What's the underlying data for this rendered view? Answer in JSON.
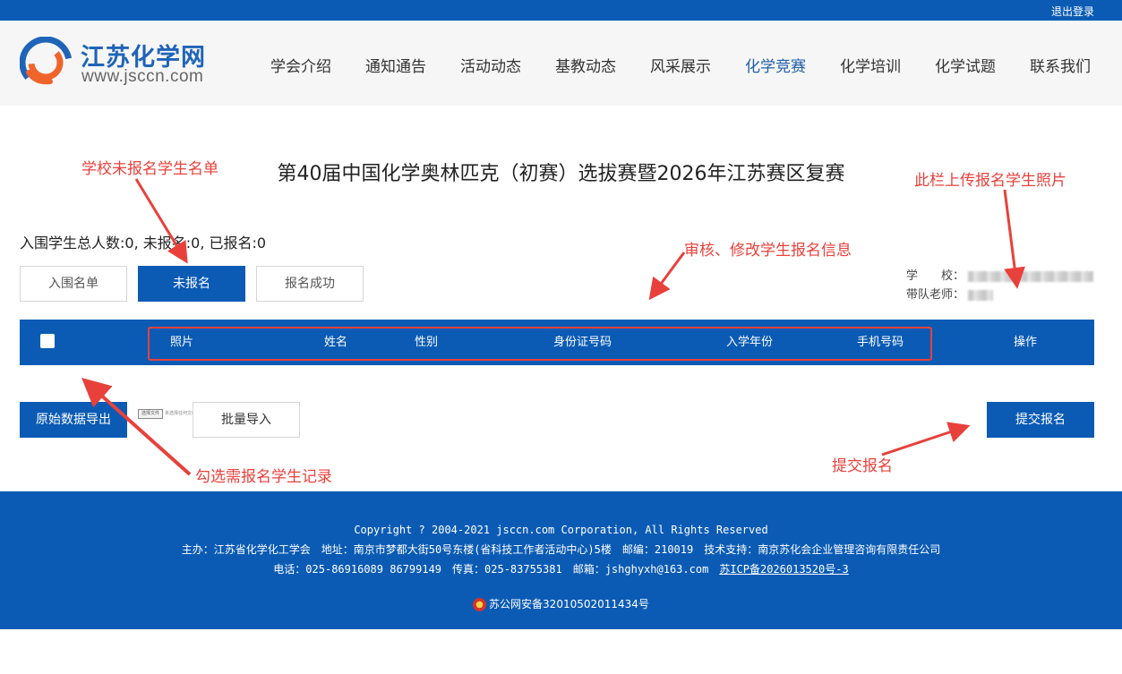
{
  "topbar": {
    "logout": "退出登录"
  },
  "brand": {
    "name": "江苏化学网",
    "url": "www.jsccn.com"
  },
  "nav": [
    "学会介绍",
    "通知通告",
    "活动动态",
    "基教动态",
    "风采展示",
    "化学竞赛",
    "化学培训",
    "化学试题",
    "联系我们"
  ],
  "nav_active": "化学竞赛",
  "page_title": "第40届中国化学奥林匹克（初赛）选拔赛暨2026年江苏赛区复赛",
  "stats": "入围学生总人数:0, 未报名:0, 已报名:0",
  "tabs": {
    "shortlist": "入围名单",
    "unregistered": "未报名",
    "registered": "报名成功"
  },
  "school_info": {
    "school_label": "学　　校：",
    "teacher_label": "带队老师："
  },
  "table": {
    "columns": {
      "photo": "照片",
      "name": "姓名",
      "gender": "性别",
      "id_number": "身份证号码",
      "enroll_year": "入学年份",
      "phone": "手机号码",
      "action": "操作"
    }
  },
  "actions": {
    "export": "原始数据导出",
    "import": "批量导入",
    "submit": "提交报名"
  },
  "mini_file": {
    "button": "选择文件",
    "status": "未选择任何文件"
  },
  "annotations": {
    "unregistered_list": "学校未报名学生名单",
    "upload_photo": "此栏上传报名学生照片",
    "review_edit": "审核、修改学生报名信息",
    "select_records": "勾选需报名学生记录",
    "submit": "提交报名"
  },
  "footer": {
    "copyright": "Copyright ? 2004-2021 jsccn.com Corporation, All Rights Reserved",
    "host": "主办：江苏省化学化工学会　地址：南京市梦都大街50号东楼(省科技工作者活动中心)5楼　邮编：210019　技术支持：南京苏化会企业管理咨询有限责任公司",
    "contact": "电话：025-86916089 86799149　传真：025-83755381　邮箱：jshghyxh@163.com　",
    "icp": "苏ICP备2026013520号-3",
    "police": "苏公网安备32010502011434号"
  },
  "colors": {
    "primary": "#0b5bb5",
    "annotation": "#e8413c",
    "header_bg": "#f6f6f6"
  }
}
